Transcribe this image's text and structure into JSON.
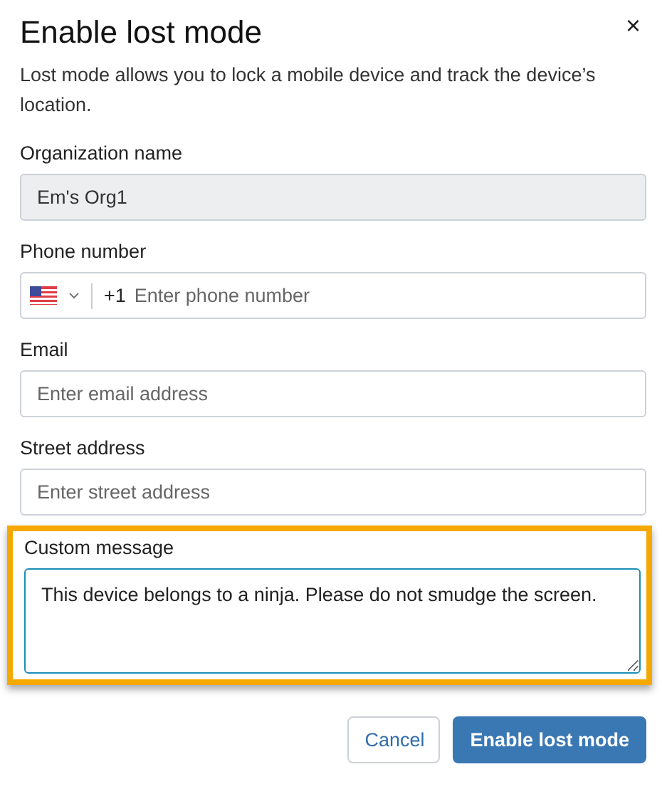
{
  "dialog": {
    "title": "Enable lost mode",
    "close": "×",
    "description": "Lost mode allows you to lock a mobile device and track the device’s location."
  },
  "fields": [
    {
      "kind": "readonly",
      "label": "Organization name",
      "value": "Em's Org1",
      "disabled": true,
      "highlighted": false
    },
    {
      "kind": "phone",
      "label": "Phone number",
      "code": "+1",
      "placeholder": "Enter phone number",
      "highlighted": false
    },
    {
      "kind": "text",
      "label": "Email",
      "placeholder": "Enter email address",
      "highlighted": false
    },
    {
      "kind": "text",
      "label": "Street address",
      "placeholder": "Enter street address",
      "highlighted": false
    },
    {
      "kind": "textarea",
      "label": "Custom message",
      "value": "This device belongs to a ninja. Please do not smudge the screen.",
      "highlighted": true
    }
  ],
  "buttons": [
    {
      "label": "Cancel",
      "kind": "secondary"
    },
    {
      "label": "Enable lost mode",
      "kind": "primary"
    }
  ]
}
